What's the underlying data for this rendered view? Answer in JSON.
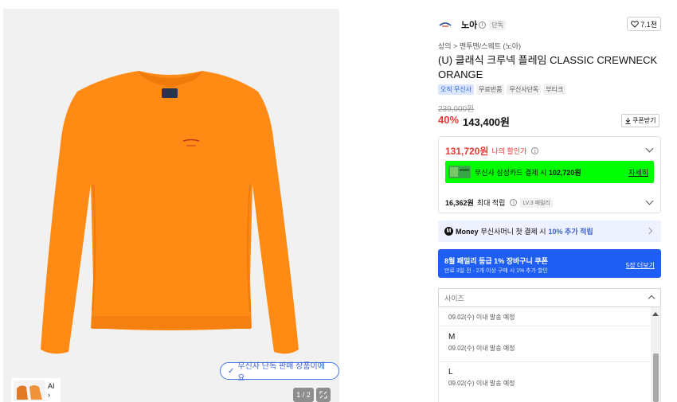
{
  "gallery": {
    "exclusive_label": "무신사 단독 판매 상품이에요",
    "thumb_label": "AI",
    "page_indicator": "1 / 2",
    "colors": {
      "sweater": "#ff8a14",
      "background": "#f1f1f1"
    }
  },
  "brand": {
    "name": "노아",
    "tag": "단독",
    "likes": "7.1천"
  },
  "product": {
    "breadcrumb": "상의 > 맨투맨/스웨트 (노아)",
    "title": "(U) 클래식 크루넥 플레임 CLASSIC CREWNECK ORANGE",
    "badges": [
      "오직 무신사",
      "무료반품",
      "무신사단독",
      "부티크"
    ]
  },
  "price": {
    "original": "239,000원",
    "discount_pct": "40%",
    "sale": "143,400원",
    "coupon_label": "쿠폰받기"
  },
  "my_price": {
    "amount": "131,720원",
    "label": "나의 할인가",
    "card_text": "무신사 삼성카드 결제 시",
    "card_price": "102,720원",
    "card_link": "자세히",
    "reward_amount": "16,362원",
    "reward_label": "최대 적립",
    "level_tag": "LV.3 패밀리"
  },
  "money_banner": {
    "icon": "M",
    "brand": "Money",
    "text": "무신사머니 첫 결제 시",
    "highlight": "10% 추가 적립"
  },
  "coupon_banner": {
    "title": "8월 패밀리 등급 1% 장바구니 쿠폰",
    "subtitle": "만료 3일 전 · 2개 이상 구매 시 1% 추가 할인",
    "link": "5장 더보기"
  },
  "size_selector": {
    "placeholder": "사이즈",
    "options": [
      {
        "name": "",
        "ship": "09.02(수) 이내 발송 예정"
      },
      {
        "name": "M",
        "ship": "09.02(수) 이내 발송 예정"
      },
      {
        "name": "L",
        "ship": "09.02(수) 이내 발송 예정"
      }
    ]
  }
}
